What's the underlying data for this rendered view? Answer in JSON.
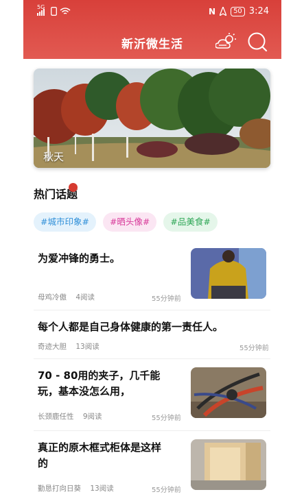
{
  "statusbar": {
    "signal_label": "5G",
    "sim_label": "2",
    "nfc": "N",
    "battery": "50",
    "time": "3:24"
  },
  "header": {
    "title": "新沂微生活"
  },
  "banner": {
    "caption": "秋天"
  },
  "hot_topics": {
    "title": "热门话题",
    "tags": [
      {
        "label": "#城市印象#",
        "color": "#2f8fd8",
        "bg": "#e4f2fc"
      },
      {
        "label": "#晒头像#",
        "color": "#d83a9a",
        "bg": "#fbe6f3"
      },
      {
        "label": "#品美食#",
        "color": "#2ea656",
        "bg": "#e5f6ea"
      }
    ]
  },
  "articles": [
    {
      "title": "为爱冲锋的勇士。",
      "author": "母鸡冷傲",
      "reads": "4阅读",
      "time": "55分钟前"
    },
    {
      "title": "每个人都是自己身体健康的第一责任人。",
      "author": "奇迹大胆",
      "reads": "13阅读",
      "time": "55分钟前"
    },
    {
      "title_line1": "70 - 80用的夹子，几千能",
      "title_line2": "玩，基本没怎么用，",
      "author": "长颈鹿任性",
      "reads": "9阅读",
      "time": "55分钟前"
    },
    {
      "title_line1": "真正的原木框式柜体是这样",
      "title_line2": "的",
      "author": "勤恳打向日葵",
      "reads": "13阅读",
      "time": "55分钟前"
    }
  ]
}
